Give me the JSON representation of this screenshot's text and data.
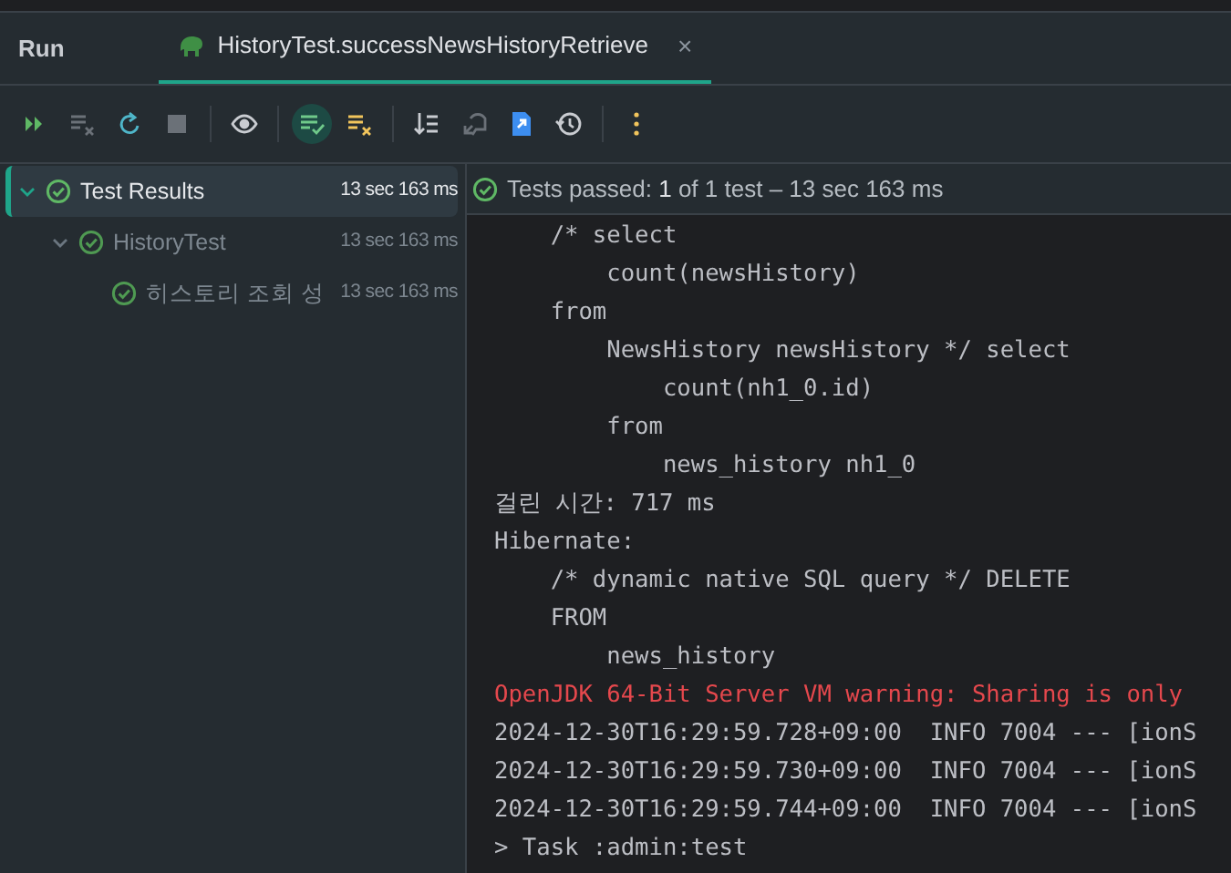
{
  "tool_window": {
    "title": "Run"
  },
  "tabs": [
    {
      "label": "HistoryTest.successNewsHistoryRetrieve",
      "selected": true,
      "close": "×"
    }
  ],
  "toolbar": [
    {
      "kind": "rerun",
      "disabled": false,
      "selected": false
    },
    {
      "kind": "rerunfailed",
      "disabled": true,
      "selected": false
    },
    {
      "kind": "toggle",
      "disabled": false,
      "selected": false
    },
    {
      "kind": "stop",
      "disabled": true,
      "selected": false
    },
    {
      "kind": "eye",
      "disabled": false,
      "selected": false
    },
    {
      "kind": "passed",
      "disabled": false,
      "selected": true
    },
    {
      "kind": "ignored",
      "disabled": false,
      "selected": false
    },
    {
      "kind": "sort",
      "disabled": false,
      "selected": false
    },
    {
      "kind": "import",
      "disabled": true,
      "selected": false
    },
    {
      "kind": "export",
      "disabled": false,
      "selected": false
    },
    {
      "kind": "history",
      "disabled": false,
      "selected": false
    },
    {
      "kind": "more",
      "disabled": false,
      "selected": false
    }
  ],
  "tree": [
    {
      "label": "Test Results",
      "time": "13 sec 163 ms",
      "selected": true,
      "expanded": true,
      "children": [
        {
          "label": "HistoryTest",
          "time": "13 sec 163 ms",
          "selected": false,
          "expanded": true,
          "children": [
            {
              "label": "히스토리 조회 성",
              "time": "13 sec 163 ms",
              "selected": false
            }
          ]
        }
      ]
    }
  ],
  "status": {
    "text": "Tests passed: **1** of 1 test – 13 sec 163 ms"
  },
  "console": [
    {
      "kind": "normal",
      "text": "    /* select"
    },
    {
      "kind": "normal",
      "text": "        count(newsHistory)"
    },
    {
      "kind": "normal",
      "text": "    from"
    },
    {
      "kind": "normal",
      "text": "        NewsHistory newsHistory */ select"
    },
    {
      "kind": "normal",
      "text": "            count(nh1_0.id)"
    },
    {
      "kind": "normal",
      "text": "        from"
    },
    {
      "kind": "normal",
      "text": "            news_history nh1_0"
    },
    {
      "kind": "normal",
      "text": "걸린 시간: 717 ms"
    },
    {
      "kind": "normal",
      "text": "Hibernate:"
    },
    {
      "kind": "normal",
      "text": "    /* dynamic native SQL query */ DELETE"
    },
    {
      "kind": "normal",
      "text": "    FROM"
    },
    {
      "kind": "normal",
      "text": "        news_history"
    },
    {
      "kind": "error",
      "text": "OpenJDK 64-Bit Server VM warning: Sharing is only"
    },
    {
      "kind": "normal",
      "text": "2024-12-30T16:29:59.728+09:00  INFO 7004 --- [ionS"
    },
    {
      "kind": "normal",
      "text": "2024-12-30T16:29:59.730+09:00  INFO 7004 --- [ionS"
    },
    {
      "kind": "normal",
      "text": "2024-12-30T16:29:59.744+09:00  INFO 7004 --- [ionS"
    },
    {
      "kind": "normal",
      "text": "> Task :admin:test"
    }
  ]
}
